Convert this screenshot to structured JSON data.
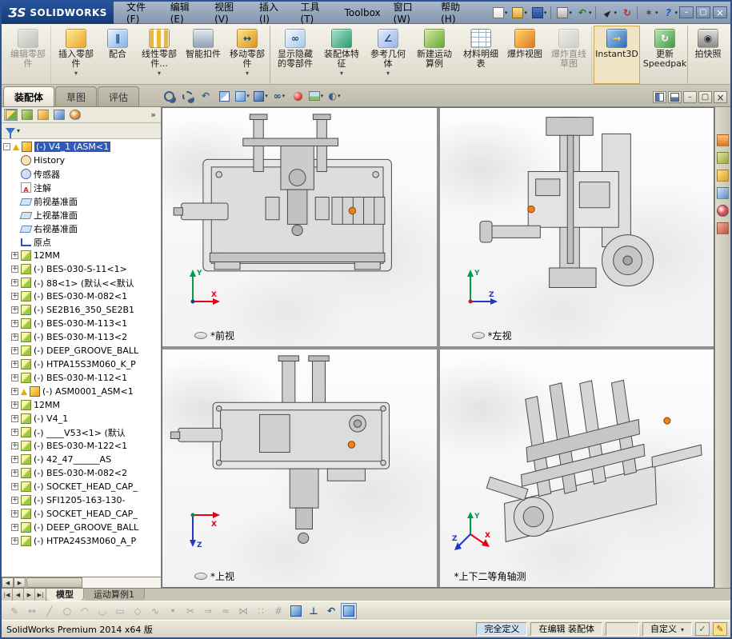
{
  "titlebar": {
    "brand_prefix": "ƷS",
    "brand": "SOLIDWORKS",
    "menu": [
      {
        "label": "文件(F)"
      },
      {
        "label": "编辑(E)"
      },
      {
        "label": "视图(V)"
      },
      {
        "label": "插入(I)"
      },
      {
        "label": "工具(T)"
      },
      {
        "label": "Toolbox"
      },
      {
        "label": "窗口(W)"
      },
      {
        "label": "帮助(H)"
      }
    ],
    "quick_icons": [
      {
        "icon": "new-document",
        "dropdown": true
      },
      {
        "icon": "open",
        "dropdown": true
      },
      {
        "icon": "save",
        "dropdown": true,
        "sep": true
      },
      {
        "icon": "print",
        "dropdown": true
      },
      {
        "icon": "undo",
        "dropdown": true,
        "sep": true
      },
      {
        "icon": "select",
        "dropdown": true
      },
      {
        "icon": "rebuild",
        "sep": true
      },
      {
        "icon": "options",
        "dropdown": true
      },
      {
        "icon": "help",
        "dropdown": true
      }
    ],
    "window_controls": [
      {
        "icon": "minimize"
      },
      {
        "icon": "maximize"
      },
      {
        "icon": "close"
      }
    ]
  },
  "ribbon": {
    "buttons": [
      {
        "label": "编辑零部件",
        "icon": "edit-component",
        "disabled": true,
        "sep": true
      },
      {
        "label": "插入零部件",
        "icon": "insert-component",
        "dropdown": true
      },
      {
        "label": "配合",
        "icon": "mate"
      },
      {
        "label": "线性零部件...",
        "icon": "linear-pattern",
        "dropdown": true
      },
      {
        "label": "智能扣件",
        "icon": "smart-fasteners"
      },
      {
        "label": "移动零部件",
        "icon": "move-component",
        "dropdown": true,
        "sep": true
      },
      {
        "label": "显示隐藏的零部件",
        "icon": "show-hidden"
      },
      {
        "label": "装配体特征",
        "icon": "assembly-features",
        "dropdown": true
      },
      {
        "label": "参考几何体",
        "icon": "reference-geometry",
        "dropdown": true
      },
      {
        "label": "新建运动算例",
        "icon": "new-motion-study"
      },
      {
        "label": "材料明细表",
        "icon": "bill-of-materials"
      },
      {
        "label": "爆炸视图",
        "icon": "exploded-view"
      },
      {
        "label": "爆炸直线草图",
        "icon": "explode-line-sketch",
        "disabled": true,
        "sep": true
      },
      {
        "label": "Instant3D",
        "icon": "instant3d",
        "toggled": true,
        "sep": true
      },
      {
        "label": "更新Speedpak",
        "icon": "update-speedpak",
        "sep": true
      },
      {
        "label": "拍快照",
        "icon": "take-snapshot"
      }
    ]
  },
  "panel_tabs": [
    {
      "label": "装配体",
      "active": true
    },
    {
      "label": "草图"
    },
    {
      "label": "评估"
    }
  ],
  "view_toolbar": [
    {
      "icon": "zoom-fit"
    },
    {
      "icon": "zoom-area"
    },
    {
      "icon": "previous-view"
    },
    {
      "icon": "section-view"
    },
    {
      "icon": "view-orientation",
      "dropdown": true
    },
    {
      "icon": "display-style",
      "dropdown": true
    },
    {
      "icon": "hide-show-items",
      "dropdown": true
    },
    {
      "icon": "edit-appearance"
    },
    {
      "icon": "apply-scene",
      "dropdown": true
    },
    {
      "icon": "view-settings",
      "dropdown": true
    }
  ],
  "doc_controls": [
    {
      "icon": "display-pane-left"
    },
    {
      "icon": "display-pane-bottom"
    },
    {
      "icon": "minimize-doc"
    },
    {
      "icon": "restore-doc"
    },
    {
      "icon": "close-doc"
    }
  ],
  "feature_panel": {
    "toolbar": [
      {
        "icon": "featuremanager-tree",
        "active": true
      },
      {
        "icon": "propertymanager"
      },
      {
        "icon": "configurationmanager"
      },
      {
        "icon": "dimxpertmanager"
      },
      {
        "icon": "displaymanager"
      }
    ],
    "overflow": "»",
    "tree": [
      {
        "text": "(-) V4_1 (ASM<1",
        "icon": "assembly",
        "warning": true,
        "selected": true,
        "root": true
      },
      {
        "text": "History",
        "icon": "history"
      },
      {
        "text": "传感器",
        "icon": "sensors"
      },
      {
        "text": "注解",
        "icon": "annotations"
      },
      {
        "text": "前视基准面",
        "icon": "plane"
      },
      {
        "text": "上视基准面",
        "icon": "plane"
      },
      {
        "text": "右视基准面",
        "icon": "plane"
      },
      {
        "text": "原点",
        "icon": "origin"
      },
      {
        "text": "12MM",
        "icon": "part",
        "expand": true
      },
      {
        "text": "(-) BES-030-S-11<1>",
        "icon": "part",
        "expand": true
      },
      {
        "text": "(-) 88<1> (默认<<默认",
        "icon": "part",
        "expand": true
      },
      {
        "text": "(-) BES-030-M-082<1",
        "icon": "part",
        "expand": true
      },
      {
        "text": "(-) SE2B16_350_SE2B1",
        "icon": "part",
        "expand": true
      },
      {
        "text": "(-) BES-030-M-113<1",
        "icon": "part",
        "expand": true
      },
      {
        "text": "(-) BES-030-M-113<2",
        "icon": "part",
        "expand": true
      },
      {
        "text": "(-) DEEP_GROOVE_BALL",
        "icon": "part",
        "expand": true
      },
      {
        "text": "(-) HTPA15S3M060_K_P",
        "icon": "part",
        "expand": true
      },
      {
        "text": "(-) BES-030-M-112<1",
        "icon": "part",
        "expand": true
      },
      {
        "text": "(-) ASM0001_ASM<1",
        "icon": "assembly",
        "warning": true,
        "expand": true
      },
      {
        "text": "12MM",
        "icon": "part",
        "expand": true
      },
      {
        "text": "(-) V4_1",
        "icon": "part",
        "expand": true
      },
      {
        "text": "(-) ____V53<1> (默认",
        "icon": "part",
        "expand": true
      },
      {
        "text": "(-) BES-030-M-122<1",
        "icon": "part",
        "expand": true
      },
      {
        "text": "(-) 42_47______AS",
        "icon": "part",
        "expand": true
      },
      {
        "text": "(-) BES-030-M-082<2",
        "icon": "part",
        "expand": true
      },
      {
        "text": "(-) SOCKET_HEAD_CAP_",
        "icon": "part",
        "expand": true
      },
      {
        "text": "(-) SFI1205-163-130-",
        "icon": "part",
        "expand": true
      },
      {
        "text": "(-) SOCKET_HEAD_CAP_",
        "icon": "part",
        "expand": true
      },
      {
        "text": "(-) DEEP_GROOVE_BALL",
        "icon": "part",
        "expand": true
      },
      {
        "text": "(-) HTPA24S3M060_A_P",
        "icon": "part",
        "expand": true
      }
    ]
  },
  "task_pane": [
    {
      "icon": "solidworks-resources"
    },
    {
      "icon": "design-library"
    },
    {
      "icon": "file-explorer"
    },
    {
      "icon": "view-palette"
    },
    {
      "icon": "appearances"
    },
    {
      "icon": "custom-properties"
    }
  ],
  "viewports": [
    {
      "label": "*前视",
      "axes": [
        {
          "label": "Y",
          "color": "#009e49"
        },
        {
          "label": "X",
          "color": "#e3001b"
        }
      ]
    },
    {
      "label": "*左视",
      "axes": [
        {
          "label": "Y",
          "color": "#009e49"
        },
        {
          "label": "Z",
          "color": "#2038c8"
        }
      ]
    },
    {
      "label": "*上视",
      "axes": [
        {
          "label": "X",
          "color": "#e3001b"
        },
        {
          "label": "Z",
          "color": "#2038c8"
        }
      ]
    },
    {
      "label": "*上下二等角轴测",
      "axes": [
        {
          "label": "Y",
          "color": "#009e49"
        },
        {
          "label": "X",
          "color": "#e3001b"
        },
        {
          "label": "Z",
          "color": "#2038c8"
        }
      ]
    }
  ],
  "modelbar": {
    "nav": [
      "|◀",
      "◀",
      "▶",
      "▶|"
    ],
    "tabs": [
      {
        "label": "模型",
        "active": true
      },
      {
        "label": "运动算例1"
      }
    ]
  },
  "sketch_toolbar": [
    {
      "icon": "sketch",
      "disabled": true
    },
    {
      "icon": "smart-dimension",
      "disabled": true
    },
    {
      "icon": "line",
      "disabled": true
    },
    {
      "icon": "circle",
      "disabled": true
    },
    {
      "icon": "arc",
      "disabled": true
    },
    {
      "icon": "ellipse",
      "disabled": true
    },
    {
      "icon": "rectangle",
      "disabled": true
    },
    {
      "icon": "polygon",
      "disabled": true
    },
    {
      "icon": "spline",
      "disabled": true
    },
    {
      "icon": "point",
      "disabled": true
    },
    {
      "icon": "trim-entities",
      "disabled": true
    },
    {
      "icon": "convert-entities",
      "disabled": true
    },
    {
      "icon": "offset-entities",
      "disabled": true
    },
    {
      "icon": "mirror-entities",
      "disabled": true
    },
    {
      "icon": "linear-sketch-pattern",
      "disabled": true
    },
    {
      "icon": "grid",
      "disabled": true
    },
    {
      "icon": "isometric-cube"
    },
    {
      "icon": "normal-to"
    },
    {
      "icon": "previous-view"
    },
    {
      "icon": "shaded-cube",
      "toggled": true
    }
  ],
  "statusbar": {
    "app": "SolidWorks Premium 2014 x64 版",
    "segments": [
      {
        "label": "完全定义",
        "highlight": true
      },
      {
        "label": "在编辑 装配体"
      },
      {
        "label": "自定义",
        "dropdown": true
      }
    ],
    "icons": [
      {
        "icon": "check"
      },
      {
        "icon": "quick-tips"
      }
    ]
  }
}
